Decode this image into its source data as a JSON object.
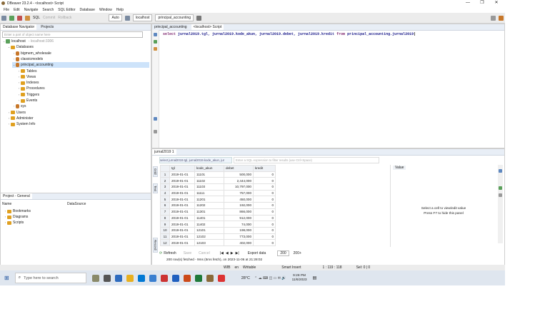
{
  "window": {
    "title": "DBeaver 23.2.4 - <localhost> Script",
    "minimize": "—",
    "maximize": "❐",
    "close": "✕"
  },
  "menu": [
    "File",
    "Edit",
    "Navigate",
    "Search",
    "SQL Editor",
    "Database",
    "Window",
    "Help"
  ],
  "toolbar": {
    "sql": "SQL",
    "commit": "Commit",
    "rollback": "Rollback",
    "mode": "Auto",
    "connection": "localhost",
    "schema": "principal_accounting"
  },
  "navigator": {
    "tabs": [
      "Database Navigator",
      "Projects"
    ],
    "filter_placeholder": "Enter a part of object name here",
    "tree": [
      {
        "label": "localhost",
        "extra": "- localhost:3306",
        "icon": "server",
        "depth": 0,
        "arrow": "⌄"
      },
      {
        "label": "Databases",
        "icon": "folder",
        "depth": 1,
        "arrow": "⌄"
      },
      {
        "label": "bigmem_wholesale",
        "icon": "db",
        "depth": 2,
        "arrow": "›"
      },
      {
        "label": "classicmodels",
        "icon": "db",
        "depth": 2,
        "arrow": "›"
      },
      {
        "label": "principal_accounting",
        "icon": "db",
        "depth": 2,
        "arrow": "⌄",
        "selected": true
      },
      {
        "label": "Tables",
        "icon": "folder",
        "depth": 3,
        "arrow": "›"
      },
      {
        "label": "Views",
        "icon": "folder",
        "depth": 3,
        "arrow": "›"
      },
      {
        "label": "Indexes",
        "icon": "folder",
        "depth": 3,
        "arrow": "›"
      },
      {
        "label": "Procedures",
        "icon": "folder",
        "depth": 3,
        "arrow": "›"
      },
      {
        "label": "Triggers",
        "icon": "folder",
        "depth": 3,
        "arrow": "›"
      },
      {
        "label": "Events",
        "icon": "folder",
        "depth": 3,
        "arrow": "›"
      },
      {
        "label": "sys",
        "icon": "db",
        "depth": 2,
        "arrow": "›"
      },
      {
        "label": "Users",
        "icon": "folder",
        "depth": 1,
        "arrow": "›"
      },
      {
        "label": "Administer",
        "icon": "folder",
        "depth": 1,
        "arrow": "›"
      },
      {
        "label": "System Info",
        "icon": "folder",
        "depth": 1,
        "arrow": "›"
      }
    ]
  },
  "project": {
    "tab": "Project - General",
    "col_name": "Name",
    "col_source": "DataSource",
    "items": [
      "Bookmarks",
      "Diagrams",
      "Scripts"
    ]
  },
  "editor": {
    "tabs": [
      "principal_accounting",
      "<localhost> Script"
    ],
    "sql_kw1": "select",
    "sql_body": " jurnal2019.tgl, jurnal2019.kode_akun, jurnal2019.debet, jurnal2019.kredit ",
    "sql_kw2": "from",
    "sql_tail": " principal_accounting.jurnal2019"
  },
  "results": {
    "tab": "jurnal2019 1",
    "filter_query": "select jurnal2019.tgl, jurnal2019.kode_akun, jur",
    "filter_placeholder": "Enter a SQL expression to filter results (use Ctrl+Space)",
    "columns": [
      "tgl",
      "kode_akun",
      "debet",
      "kredit"
    ],
    "rows": [
      [
        "1",
        "2019-01-01",
        "11101",
        "500,000",
        "0"
      ],
      [
        "2",
        "2019-01-01",
        "11102",
        "2,444,000",
        "0"
      ],
      [
        "3",
        "2019-01-01",
        "11103",
        "10,797,000",
        "0"
      ],
      [
        "4",
        "2019-01-01",
        "11111",
        "757,000",
        "0"
      ],
      [
        "5",
        "2019-01-01",
        "11201",
        "450,000",
        "0"
      ],
      [
        "6",
        "2019-01-01",
        "11202",
        "192,000",
        "0"
      ],
      [
        "7",
        "2019-01-01",
        "11301",
        "866,000",
        "0"
      ],
      [
        "8",
        "2019-01-01",
        "11401",
        "912,000",
        "0"
      ],
      [
        "9",
        "2019-01-01",
        "11402",
        "74,000",
        "0"
      ],
      [
        "10",
        "2019-01-01",
        "12101",
        "198,000",
        "0"
      ],
      [
        "11",
        "2019-01-01",
        "12102",
        "773,000",
        "0"
      ],
      [
        "12",
        "2019-01-01",
        "12103",
        "402,000",
        "0"
      ]
    ],
    "value_panel_title": "Value",
    "value_hint_1": "Select a cell to view/edit value",
    "value_hint_2": "Press F7 to hide this panel",
    "side_tabs": [
      "Grid",
      "Text",
      "Record"
    ],
    "refresh": "Refresh",
    "save": "Save",
    "cancel": "Cancel",
    "export": "Export data",
    "fetch_size": "200",
    "fetch_label": "200+",
    "fetched": "200 row(s) fetched - 9ms (5ms fetch), on 2023-11-06 at 21:28:02"
  },
  "status": {
    "lang": "WIB",
    "locale": "en",
    "mode": "Writable",
    "insert": "Smart Insert",
    "pos": "1 : 119 : 118",
    "sel": "Sel: 0 | 0"
  },
  "taskbar": {
    "search": "Type here to search",
    "temp": "28°C",
    "time": "9:28 PM",
    "date": "11/6/2023"
  },
  "colors": {
    "accent": "#3c6fb6",
    "selection": "#cde3fa",
    "folder": "#e0a020",
    "db": "#c7772a"
  }
}
